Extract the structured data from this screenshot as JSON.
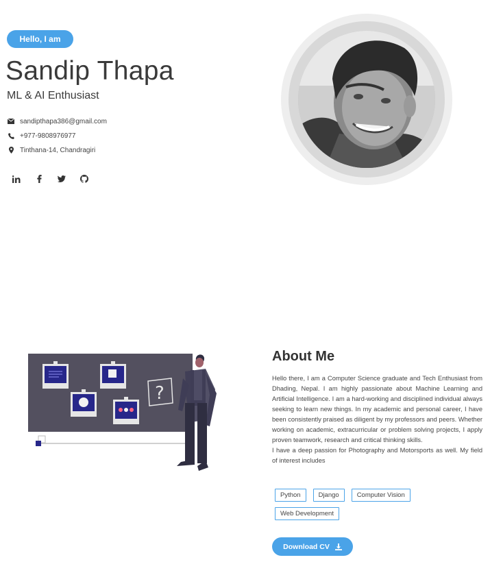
{
  "hero": {
    "badge": "Hello, I am",
    "name": "Sandip Thapa",
    "role": "ML & AI Enthusiast",
    "email": "sandipthapa386@gmail.com",
    "phone": "+977-9808976977",
    "address": "Tinthana-14, Chandragiri",
    "socials": [
      "linkedin-icon",
      "facebook-icon",
      "twitter-icon",
      "github-icon"
    ]
  },
  "about": {
    "title": "About Me",
    "paragraph1": "Hello there, I am a Computer Science graduate and Tech Enthusiast from Dhading, Nepal. I am highly passionate about Machine Learning and Artificial Intelligence. I am a hard-working and disciplined individual always seeking to learn new things. In my academic and personal career, I have been consistently praised as diligent by my professors and peers. Whether working on academic, extracurricular or problem solving projects, I apply proven teamwork, research and critical thinking skills.",
    "paragraph2": "I have a deep passion for Photography and Motorsports as well. My field of interest includes",
    "tags": [
      "Python",
      "Django",
      "Computer Vision",
      "Web Development"
    ],
    "cv_button": "Download CV"
  },
  "colors": {
    "accent": "#4aa3e8",
    "text": "#333333"
  }
}
